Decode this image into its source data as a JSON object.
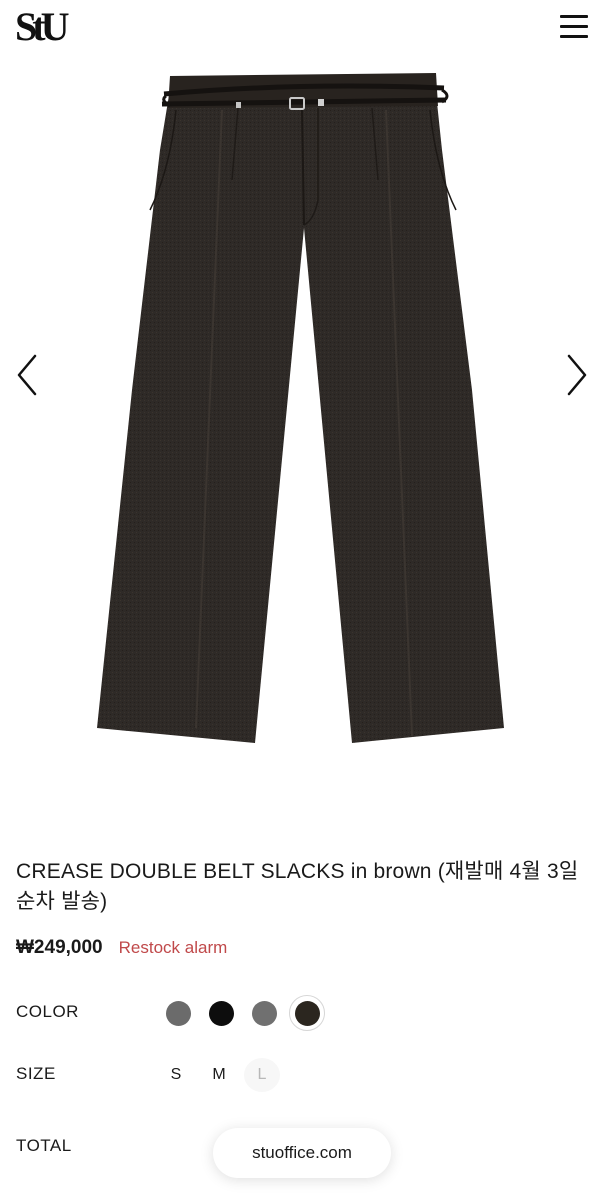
{
  "header": {
    "logo": "StU",
    "menu_icon": "hamburger-menu-icon"
  },
  "gallery": {
    "prev_icon": "chevron-left-icon",
    "next_icon": "chevron-right-icon"
  },
  "product": {
    "title": "CREASE DOUBLE BELT SLACKS in brown (재발매 4월 3일 순차 발송)",
    "price": "₩249,000",
    "restock_label": "Restock alarm"
  },
  "options": {
    "color_label": "COLOR",
    "colors": [
      {
        "hex": "#6b6b6b",
        "selected": false
      },
      {
        "hex": "#0d0d0d",
        "selected": false
      },
      {
        "hex": "#707070",
        "selected": false
      },
      {
        "hex": "#2b261f",
        "selected": true
      }
    ],
    "size_label": "SIZE",
    "sizes": [
      {
        "label": "S",
        "available": true
      },
      {
        "label": "M",
        "available": true
      },
      {
        "label": "L",
        "available": false
      }
    ],
    "total_label": "TOTAL"
  },
  "browser": {
    "url": "stuoffice.com"
  },
  "colors": {
    "restock": "#c0494a",
    "garment": "#2e2a27",
    "belt": "#1a1716"
  }
}
